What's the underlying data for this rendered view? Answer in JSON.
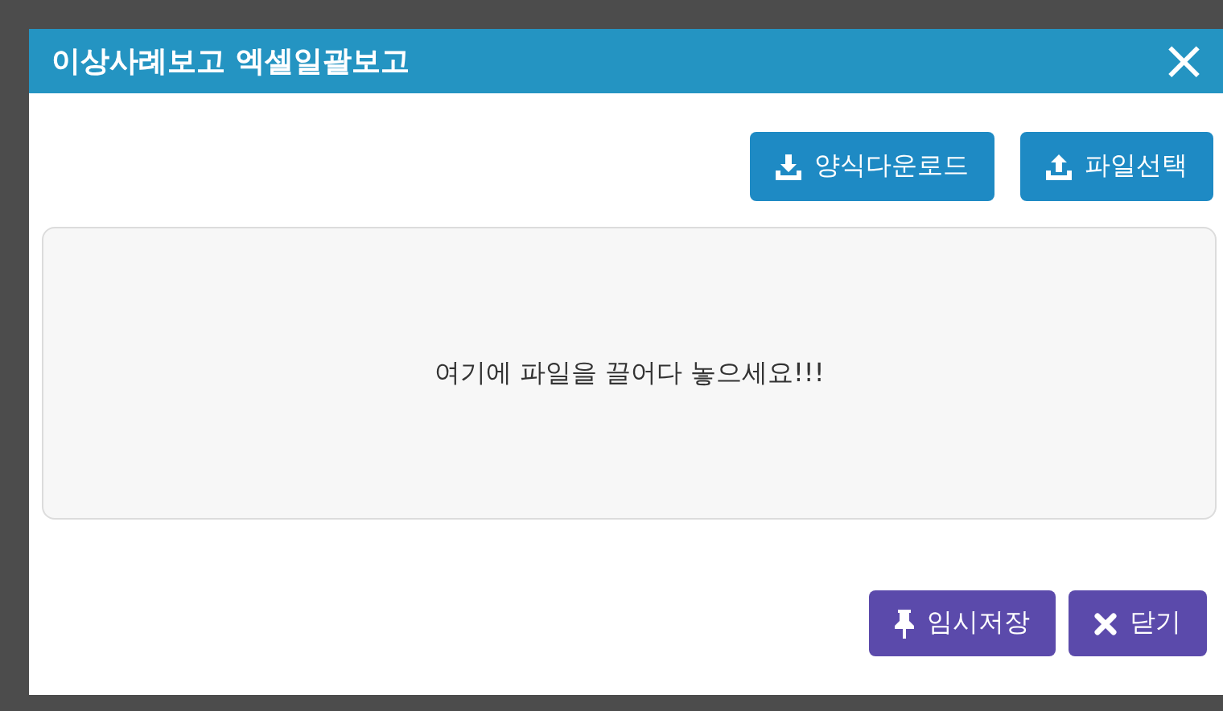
{
  "dialog": {
    "title": "이상사례보고 엑셀일괄보고",
    "close": "×"
  },
  "top_buttons": [
    {
      "kind": "download",
      "label": "양식다운로드"
    },
    {
      "kind": "upload",
      "label": "파일선택"
    }
  ],
  "drop_zone": {
    "text": "여기에 파일을 끌어다 놓으세요!!!"
  },
  "bottom_buttons": [
    {
      "kind": "pin",
      "label": "임시저장"
    },
    {
      "kind": "close",
      "label": "닫기"
    }
  ]
}
